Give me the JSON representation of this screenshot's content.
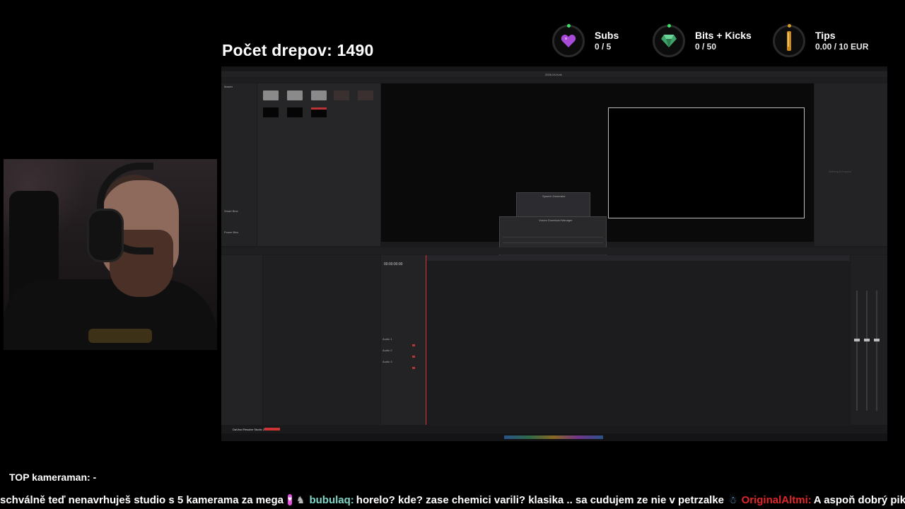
{
  "overlay": {
    "title": "Počet drepov: 1490",
    "goals": [
      {
        "name": "Subs",
        "value": "0 / 5",
        "icon": "purple-heart-icon"
      },
      {
        "name": "Bits + Kicks",
        "value": "0 / 50",
        "icon": "green-gem-icon"
      },
      {
        "name": "Tips",
        "value": "0.00 / 10 EUR",
        "icon": "tip-bar-icon"
      }
    ],
    "top_cameraman": "TOP kameraman: -"
  },
  "app": {
    "project_title": "2026-04-Kvik",
    "timecode": "00:00:00:00",
    "viewer_placeholder": "Nothing to inspect",
    "dialog_title": "Speech Generator",
    "download_manager_title": "Voices Download Manager",
    "brand": "DaVinci Resolve Studio 20",
    "audio_tracks": [
      "Audio 1",
      "Audio 2",
      "Audio 3"
    ],
    "panels": [
      "Master",
      "Smart Bins",
      "Power Bins",
      "Timeline"
    ]
  },
  "chat": {
    "segments": [
      {
        "text": "schválně teď nenavrhuješ studio s 5 kamerama za mega",
        "color": "#ffffff",
        "emote": "heart-emote"
      },
      {
        "user": "bubulaq:",
        "user_color": "#7fd6c8",
        "text": "horelo? kde? zase chemici varili? klasika .. sa cudujem ze nie v petrzalke",
        "emote": "wolf-emote"
      },
      {
        "user": "OriginalAltmi:",
        "user_color": "#e0262b",
        "text": "A aspoň dobrý piko?",
        "emote": "blue-bot-emote"
      }
    ]
  },
  "colors": {
    "background": "#000000",
    "accent_green": "#3ce06b",
    "heart": "#b04ad8",
    "gem": "#3fa36a",
    "tips": "#c98a1a",
    "playhead": "#e23b3b"
  }
}
